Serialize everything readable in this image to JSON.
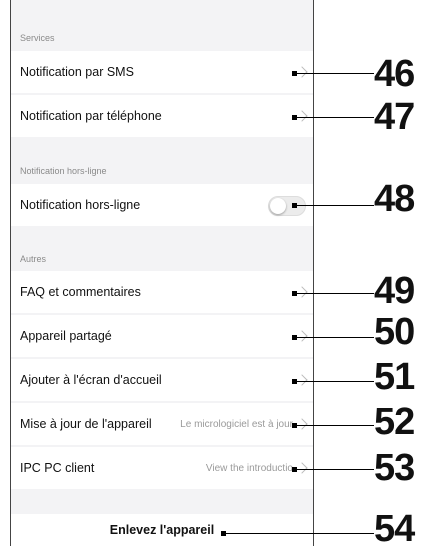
{
  "sections": {
    "services": "Services",
    "offline": "Notification hors-ligne",
    "other": "Autres"
  },
  "rows": {
    "sms": "Notification par SMS",
    "phone": "Notification par téléphone",
    "offline": "Notification hors-ligne",
    "faq": "FAQ et commentaires",
    "shared": "Appareil partagé",
    "homescreen": "Ajouter à l'écran d'accueil",
    "firmware": "Mise à jour de l'appareil",
    "firmware_value": "Le micrologiciel est à jour",
    "ipc": "IPC PC client",
    "ipc_value": "View the introductio"
  },
  "toggle_offline_on": false,
  "remove_button": "Enlevez l'appareil",
  "callouts": [
    "46",
    "47",
    "48",
    "49",
    "50",
    "51",
    "52",
    "53",
    "54"
  ]
}
